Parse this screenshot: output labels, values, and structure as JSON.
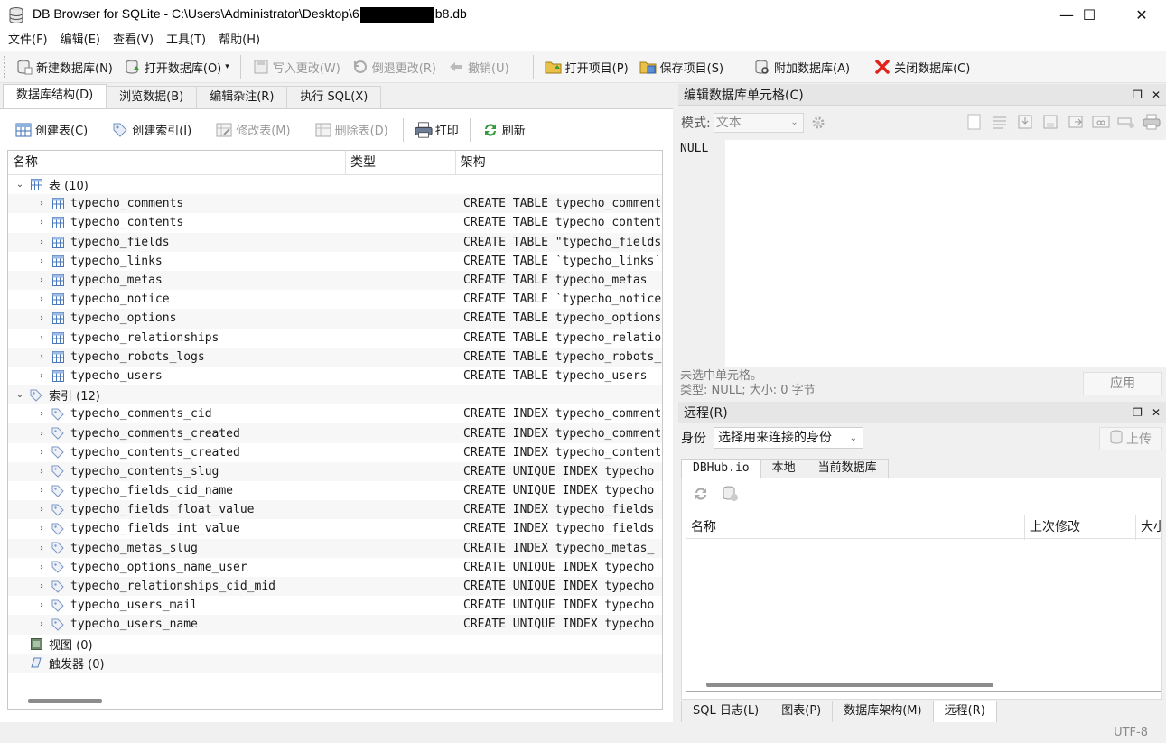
{
  "window": {
    "title_prefix": "DB Browser for SQLite - C:\\Users\\Administrator\\Desktop\\6",
    "title_suffix": "b8.db",
    "minimize": "—",
    "maximize": "☐",
    "close": "✕"
  },
  "menu": [
    "文件(F)",
    "编辑(E)",
    "查看(V)",
    "工具(T)",
    "帮助(H)"
  ],
  "toolbar": {
    "new_db": "新建数据库(N)",
    "open_db": "打开数据库(O)",
    "write_changes": "写入更改(W)",
    "revert_changes": "倒退更改(R)",
    "undo": "撤销(U)",
    "open_project": "打开项目(P)",
    "save_project": "保存项目(S)",
    "attach_db": "附加数据库(A)",
    "close_db": "关闭数据库(C)"
  },
  "main_tabs": [
    "数据库结构(D)",
    "浏览数据(B)",
    "编辑杂注(R)",
    "执行 SQL(X)"
  ],
  "structure_toolbar": {
    "create_table": "创建表(C)",
    "create_index": "创建索引(I)",
    "modify_table": "修改表(M)",
    "delete_table": "删除表(D)",
    "print": "打印",
    "refresh": "刷新"
  },
  "tree": {
    "columns": [
      "名称",
      "类型",
      "架构"
    ],
    "tables_label": "表 (10)",
    "tables": [
      {
        "name": "typecho_comments",
        "schema": "CREATE TABLE typecho_comments"
      },
      {
        "name": "typecho_contents",
        "schema": "CREATE TABLE typecho_contents"
      },
      {
        "name": "typecho_fields",
        "schema": "CREATE TABLE \"typecho_fields\""
      },
      {
        "name": "typecho_links",
        "schema": "CREATE TABLE `typecho_links`"
      },
      {
        "name": "typecho_metas",
        "schema": "CREATE TABLE typecho_metas"
      },
      {
        "name": "typecho_notice",
        "schema": "CREATE TABLE `typecho_notice`"
      },
      {
        "name": "typecho_options",
        "schema": "CREATE TABLE typecho_options"
      },
      {
        "name": "typecho_relationships",
        "schema": "CREATE TABLE typecho_relationships"
      },
      {
        "name": "typecho_robots_logs",
        "schema": "CREATE TABLE typecho_robots_logs"
      },
      {
        "name": "typecho_users",
        "schema": "CREATE TABLE typecho_users"
      }
    ],
    "indexes_label": "索引 (12)",
    "indexes": [
      {
        "name": "typecho_comments_cid",
        "schema": "CREATE INDEX typecho_comments"
      },
      {
        "name": "typecho_comments_created",
        "schema": "CREATE INDEX typecho_comments"
      },
      {
        "name": "typecho_contents_created",
        "schema": "CREATE INDEX typecho_contents"
      },
      {
        "name": "typecho_contents_slug",
        "schema": "CREATE UNIQUE INDEX typecho"
      },
      {
        "name": "typecho_fields_cid_name",
        "schema": "CREATE UNIQUE INDEX typecho"
      },
      {
        "name": "typecho_fields_float_value",
        "schema": "CREATE INDEX typecho_fields"
      },
      {
        "name": "typecho_fields_int_value",
        "schema": "CREATE INDEX typecho_fields"
      },
      {
        "name": "typecho_metas_slug",
        "schema": "CREATE INDEX typecho_metas_"
      },
      {
        "name": "typecho_options_name_user",
        "schema": "CREATE UNIQUE INDEX typecho"
      },
      {
        "name": "typecho_relationships_cid_mid",
        "schema": "CREATE UNIQUE INDEX typecho"
      },
      {
        "name": "typecho_users_mail",
        "schema": "CREATE UNIQUE INDEX typecho"
      },
      {
        "name": "typecho_users_name",
        "schema": "CREATE UNIQUE INDEX typecho"
      }
    ],
    "views_label": "视图 (0)",
    "triggers_label": "触发器 (0)"
  },
  "edit_cell": {
    "title": "编辑数据库单元格(C)",
    "mode_label": "模式:",
    "mode_value": "文本",
    "null_text": "NULL",
    "status_line1": "未选中单元格。",
    "status_line2": "类型: NULL; 大小: 0 字节",
    "apply": "应用"
  },
  "remote": {
    "title": "远程(R)",
    "identity_label": "身份",
    "identity_value": "选择用来连接的身份",
    "upload": "上传",
    "tabs": [
      "DBHub.io",
      "本地",
      "当前数据库"
    ],
    "columns": [
      "名称",
      "上次修改",
      "大小"
    ]
  },
  "bottom_tabs": [
    "SQL 日志(L)",
    "图表(P)",
    "数据库架构(M)",
    "远程(R)"
  ],
  "status": {
    "encoding": "UTF-8"
  }
}
